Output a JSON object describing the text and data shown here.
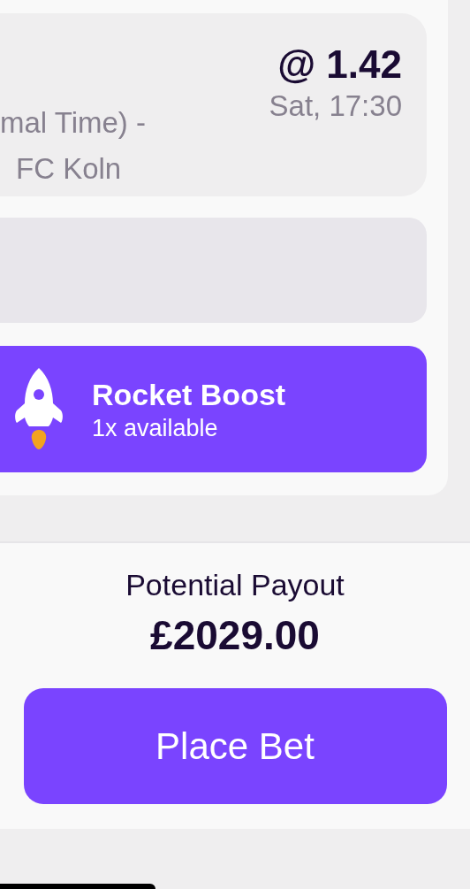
{
  "selection": {
    "market_lines": [
      "mal Time) -",
      "FC Koln"
    ],
    "odds": "@ 1.42",
    "time": "Sat, 17:30"
  },
  "boost": {
    "title": "Rocket Boost",
    "subtitle": "1x available"
  },
  "payout": {
    "label": "Potential Payout",
    "amount": "£2029.00"
  },
  "buttons": [
    "Place Bet"
  ]
}
